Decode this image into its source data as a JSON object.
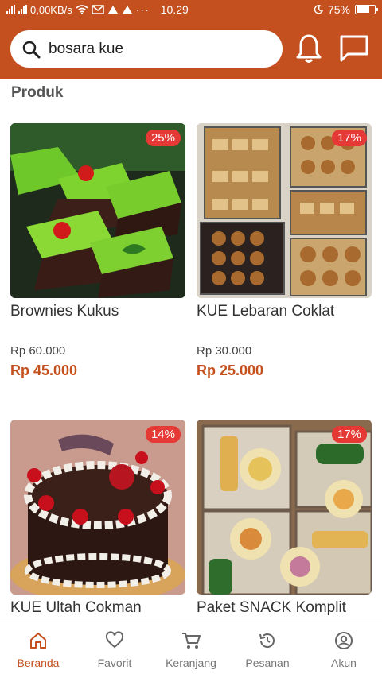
{
  "status": {
    "network": "0,00KB/s",
    "time": "10.29",
    "battery": "75%",
    "battery_level": 0.75
  },
  "search": {
    "query": "bosara kue"
  },
  "section": {
    "title": "Produk"
  },
  "products": [
    {
      "name": "Brownies Kukus",
      "discount": "25%",
      "old_price": "Rp 60.000",
      "price": "Rp 45.000"
    },
    {
      "name": "KUE Lebaran Coklat",
      "discount": "17%",
      "old_price": "Rp 30.000",
      "price": "Rp 25.000"
    },
    {
      "name": "KUE Ultah Cokman",
      "discount": "14%"
    },
    {
      "name": "Paket SNACK Komplit",
      "discount": "17%"
    }
  ],
  "nav": [
    {
      "label": "Beranda",
      "icon": "home-icon",
      "active": true
    },
    {
      "label": "Favorit",
      "icon": "heart-icon"
    },
    {
      "label": "Keranjang",
      "icon": "cart-icon"
    },
    {
      "label": "Pesanan",
      "icon": "history-icon"
    },
    {
      "label": "Akun",
      "icon": "account-icon"
    }
  ],
  "colors": {
    "brand": "#c4501f",
    "badge": "#e53935"
  }
}
